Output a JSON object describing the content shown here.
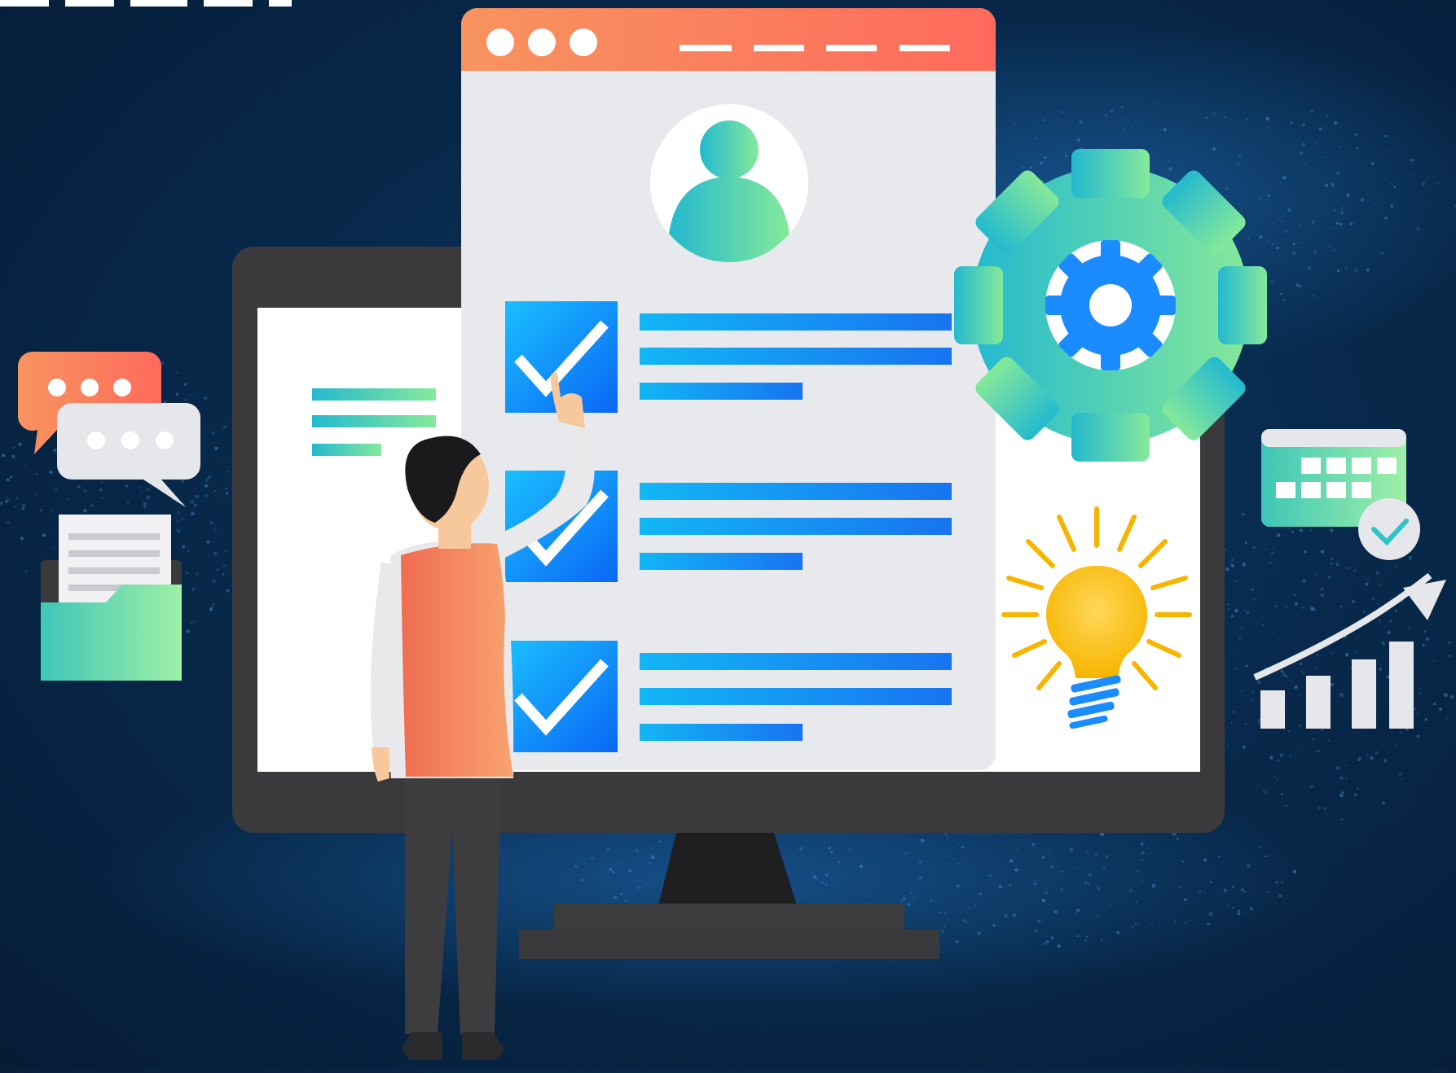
{
  "scene": {
    "background_color": "#062447",
    "accent_orange": "#f47b5a",
    "accent_teal": "#2ec4c6",
    "accent_green": "#7ee6a0",
    "accent_blue": "#1a8cff",
    "icons": [
      "chat-bubbles-icon",
      "folder-icon",
      "monitor-icon",
      "browser-window-icon",
      "user-avatar-icon",
      "checkbox-icon",
      "gear-icon",
      "lightbulb-icon",
      "calendar-icon",
      "growth-chart-icon",
      "person-figure"
    ],
    "checklist": {
      "item_count": 3,
      "checked": [
        true,
        true,
        true
      ]
    }
  }
}
